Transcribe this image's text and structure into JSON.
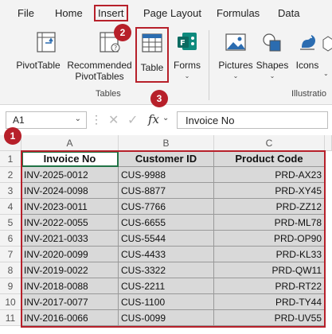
{
  "menu": {
    "items": [
      "File",
      "Home",
      "Insert",
      "Page Layout",
      "Formulas",
      "Data"
    ],
    "active": "Insert"
  },
  "ribbon": {
    "pivot_table": "PivotTable",
    "recommended_1": "Recommended",
    "recommended_2": "PivotTables",
    "table": "Table",
    "forms": "Forms",
    "pictures": "Pictures",
    "shapes": "Shapes",
    "icons": "Icons",
    "group_tables": "Tables",
    "group_illustrations": "Illustratio"
  },
  "badges": {
    "one": "1",
    "two": "2",
    "three": "3"
  },
  "formula_bar": {
    "name_box": "A1",
    "fx": "fx",
    "content": "Invoice No"
  },
  "grid": {
    "columns": [
      "A",
      "B",
      "C"
    ],
    "rows": [
      "1",
      "2",
      "3",
      "4",
      "5",
      "6",
      "7",
      "8",
      "9",
      "10",
      "11"
    ],
    "headers": [
      "Invoice No",
      "Customer ID",
      "Product Code"
    ],
    "data": [
      [
        "INV-2025-0012",
        "CUS-9988",
        "PRD-AX23"
      ],
      [
        "INV-2024-0098",
        "CUS-8877",
        "PRD-XY45"
      ],
      [
        "INV-2023-0011",
        "CUS-7766",
        "PRD-ZZ12"
      ],
      [
        "INV-2022-0055",
        "CUS-6655",
        "PRD-ML78"
      ],
      [
        "INV-2021-0033",
        "CUS-5544",
        "PRD-OP90"
      ],
      [
        "INV-2020-0099",
        "CUS-4433",
        "PRD-KL33"
      ],
      [
        "INV-2019-0022",
        "CUS-3322",
        "PRD-QW11"
      ],
      [
        "INV-2018-0088",
        "CUS-2211",
        "PRD-RT22"
      ],
      [
        "INV-2017-0077",
        "CUS-1100",
        "PRD-TY44"
      ],
      [
        "INV-2016-0066",
        "CUS-0099",
        "PRD-UV55"
      ]
    ]
  },
  "colors": {
    "highlight": "#b7202a",
    "cell_fill": "#d9d9d9",
    "excel_green": "#217346"
  }
}
